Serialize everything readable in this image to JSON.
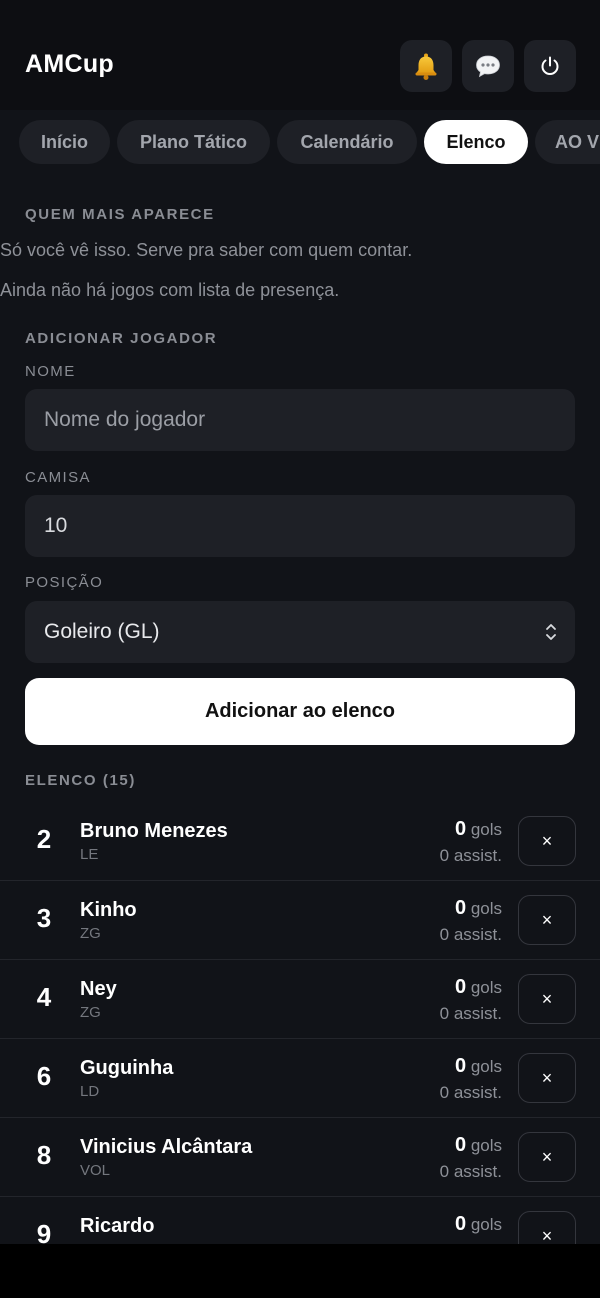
{
  "app": {
    "title": "AMCup"
  },
  "header": {
    "icons": {
      "notifications": "bell-icon",
      "messages": "chat-bubble-icon",
      "logout": "power-icon"
    }
  },
  "tabs": [
    {
      "label": "Início",
      "active": false
    },
    {
      "label": "Plano Tático",
      "active": false
    },
    {
      "label": "Calendário",
      "active": false
    },
    {
      "label": "Elenco",
      "active": true
    },
    {
      "label": "AO V",
      "active": false
    }
  ],
  "attendance": {
    "heading": "QUEM MAIS APARECE",
    "description": "Só você vê isso. Serve pra saber com quem contar.",
    "empty_message": "Ainda não há jogos com lista de presença."
  },
  "add_player": {
    "heading": "ADICIONAR JOGADOR",
    "name_label": "NOME",
    "name_placeholder": "Nome do jogador",
    "shirt_label": "CAMISA",
    "shirt_value": "10",
    "position_label": "POSIÇÃO",
    "position_value": "Goleiro (GL)",
    "submit_label": "Adicionar ao elenco"
  },
  "roster": {
    "heading": "ELENCO (15)",
    "goals_unit": "gols",
    "remove_symbol": "×",
    "players": [
      {
        "number": "2",
        "name": "Bruno Menezes",
        "position": "LE",
        "goals": "0",
        "assists": "0 assist."
      },
      {
        "number": "3",
        "name": "Kinho",
        "position": "ZG",
        "goals": "0",
        "assists": "0 assist."
      },
      {
        "number": "4",
        "name": "Ney",
        "position": "ZG",
        "goals": "0",
        "assists": "0 assist."
      },
      {
        "number": "6",
        "name": "Guguinha",
        "position": "LD",
        "goals": "0",
        "assists": "0 assist."
      },
      {
        "number": "8",
        "name": "Vinicius Alcântara",
        "position": "VOL",
        "goals": "0",
        "assists": "0 assist."
      },
      {
        "number": "9",
        "name": "Ricardo",
        "position": "",
        "goals": "0",
        "assists": ""
      }
    ]
  },
  "colors": {
    "background": "#111318",
    "surface": "#1e2026",
    "accent": "#ffffff",
    "muted": "#8e9198"
  }
}
